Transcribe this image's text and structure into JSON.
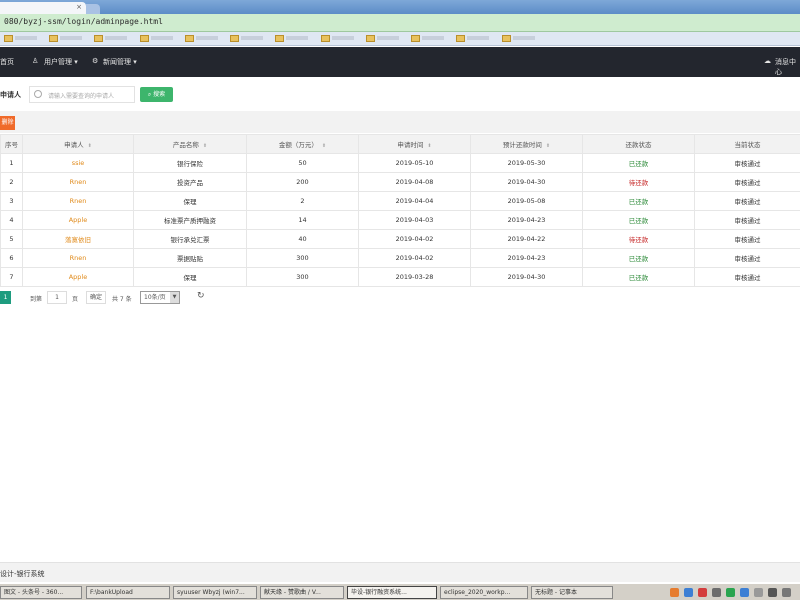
{
  "browser": {
    "tab_close": "×",
    "address": "080/byzj-ssm/login/adminpage.html"
  },
  "navbar": {
    "home": "首页",
    "user_mgmt": "用户管理 ▾",
    "news_mgmt": "新闻管理 ▾",
    "messages": "消息中心"
  },
  "search": {
    "label": "申请人",
    "placeholder": "请输入需要查询的申请人",
    "button": "搜索"
  },
  "toolbar": {
    "delete": "删除"
  },
  "table": {
    "headers": [
      "序号",
      "申请人",
      "产品名称",
      "金额（万元）",
      "申请时间",
      "预计还款时间",
      "还款状态",
      "当前状态"
    ],
    "rows": [
      [
        "1",
        "ssie",
        "银行保险",
        "50",
        "2019-05-10",
        "2019-05-30",
        "已还款",
        "审核通过"
      ],
      [
        "2",
        "Rnen",
        "投资产品",
        "200",
        "2019-04-08",
        "2019-04-30",
        "待还款",
        "审核通过"
      ],
      [
        "3",
        "Rnen",
        "保理",
        "2",
        "2019-04-04",
        "2019-05-08",
        "已还款",
        "审核通过"
      ],
      [
        "4",
        "Apple",
        "标准票产质押融资",
        "14",
        "2019-04-03",
        "2019-04-23",
        "已还款",
        "审核通过"
      ],
      [
        "5",
        "落寞依旧",
        "银行承兑汇票",
        "40",
        "2019-04-02",
        "2019-04-22",
        "待还款",
        "审核通过"
      ],
      [
        "6",
        "Rnen",
        "票据贴贴",
        "300",
        "2019-04-02",
        "2019-04-23",
        "已还款",
        "审核通过"
      ],
      [
        "7",
        "Apple",
        "保理",
        "300",
        "2019-03-28",
        "2019-04-30",
        "已还款",
        "审核通过"
      ]
    ]
  },
  "pager": {
    "current": "1",
    "goto": "到第",
    "page_value": "1",
    "page_unit": "页",
    "confirm": "确定",
    "total": "共 7 条",
    "page_size": "10条/页",
    "refresh": "↻"
  },
  "footer": {
    "text": "设计-银行系统"
  },
  "taskbar": {
    "items": [
      "图文 - 头条号 - 360...",
      "F:\\bankUpload",
      "syuuser Wbyzj (win7...",
      "献天缘 - 赞歌曲 / V...",
      "毕设-银行融资系统...",
      "eclipse_2020_workp...",
      "无标题 - 记事本"
    ]
  },
  "colors": {
    "navbar": "#23262e",
    "search_button": "#3db56c",
    "delete_button": "#f06a2a",
    "applicant": "#e08a1a",
    "repaid": "#2e8b3a",
    "pending": "#c62828",
    "pager_current": "#1e9c7f"
  }
}
